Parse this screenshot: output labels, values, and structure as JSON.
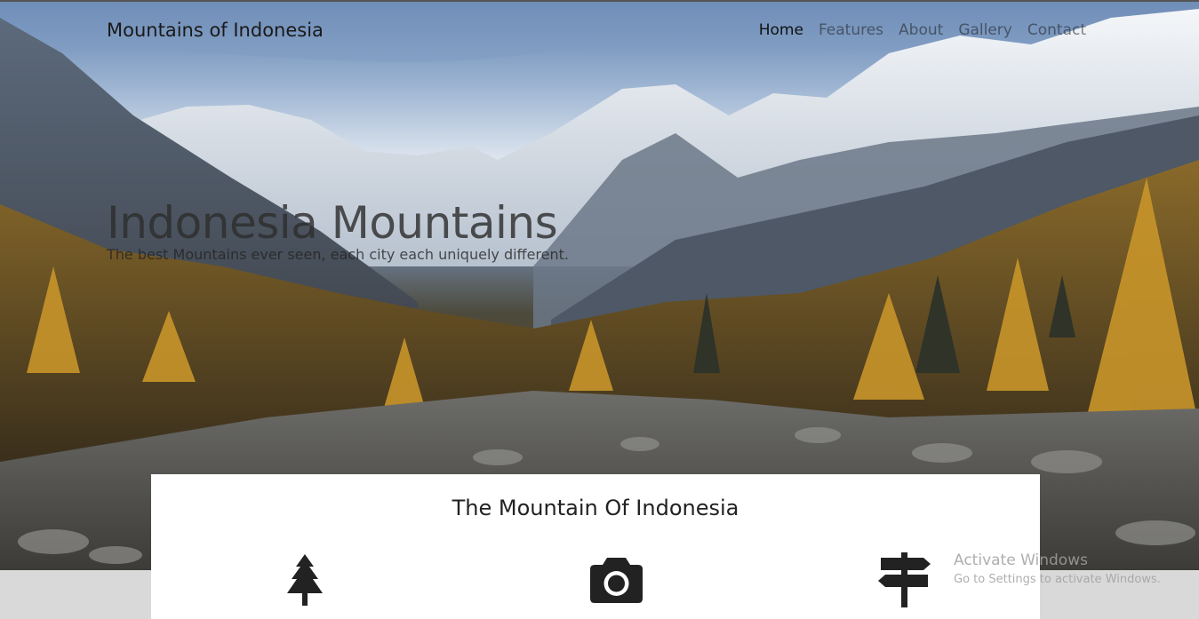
{
  "header": {
    "brand": "Mountains of Indonesia",
    "nav": [
      {
        "label": "Home",
        "active": true
      },
      {
        "label": "Features",
        "active": false
      },
      {
        "label": "About",
        "active": false
      },
      {
        "label": "Gallery",
        "active": false
      },
      {
        "label": "Contact",
        "active": false
      }
    ]
  },
  "hero": {
    "title": "Indonesia Mountains",
    "subtitle": "The best Mountains ever seen, each city each uniquely different."
  },
  "section": {
    "title": "The Mountain Of Indonesia",
    "icons": [
      "tree-icon",
      "camera-icon",
      "signpost-icon"
    ]
  },
  "watermark": {
    "line1": "Activate Windows",
    "line2": "Go to Settings to activate Windows."
  },
  "colors": {
    "icon": "#222222",
    "card_bg": "#ffffff",
    "page_bg": "#d9d9d9"
  }
}
